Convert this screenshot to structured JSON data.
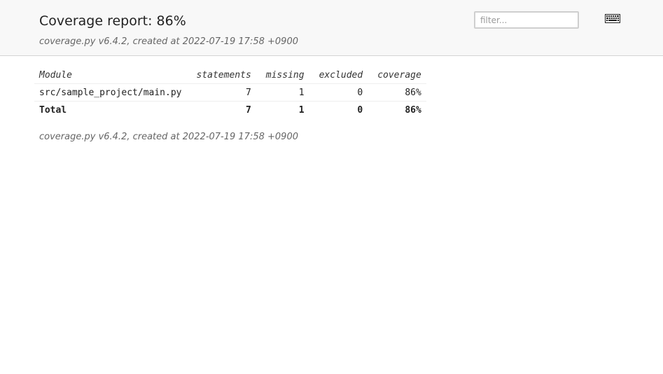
{
  "header": {
    "title": "Coverage report: 86%",
    "created": "coverage.py v6.4.2, created at 2022-07-19 17:58 +0900",
    "filter_placeholder": "filter...",
    "keyboard_icon": "keyboard-icon"
  },
  "table": {
    "columns": {
      "module": "Module",
      "statements": "statements",
      "missing": "missing",
      "excluded": "excluded",
      "coverage": "coverage"
    },
    "rows": [
      {
        "module": "src/sample_project/main.py",
        "statements": "7",
        "missing": "1",
        "excluded": "0",
        "coverage": "86%"
      }
    ],
    "total": {
      "label": "Total",
      "statements": "7",
      "missing": "1",
      "excluded": "0",
      "coverage": "86%"
    }
  },
  "footer": {
    "created": "coverage.py v6.4.2, created at 2022-07-19 17:58 +0900"
  },
  "colors": {
    "header_bg": "#f8f8f8",
    "border": "#d4d4d4",
    "muted_text": "#666666"
  }
}
